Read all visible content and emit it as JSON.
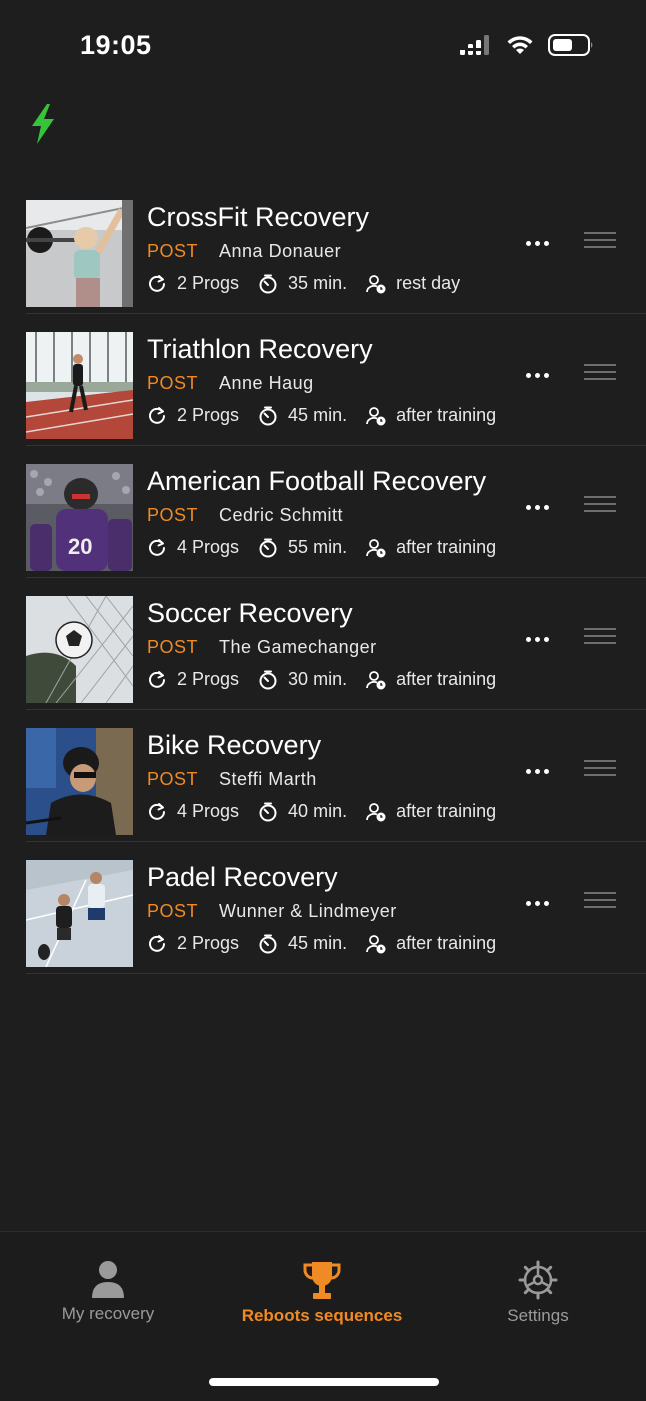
{
  "status": {
    "time": "19:05"
  },
  "colors": {
    "accent": "#f08a24",
    "bolt": "#35c43a",
    "background": "#1e1e1e"
  },
  "icons": {
    "header": "lightning-bolt-icon",
    "progs": "refresh-icon",
    "duration": "timer-icon",
    "timing": "user-clock-icon",
    "more": "more-dots-icon",
    "reorder": "drag-handle-icon"
  },
  "items": [
    {
      "title": "CrossFit Recovery",
      "tag": "POST",
      "author": "Anna Donauer",
      "progs": "2 Progs",
      "duration": "35 min.",
      "timing": "rest day"
    },
    {
      "title": "Triathlon Recovery",
      "tag": "POST",
      "author": "Anne Haug",
      "progs": "2 Progs",
      "duration": "45 min.",
      "timing": "after training"
    },
    {
      "title": "American Football Recovery",
      "tag": "POST",
      "author": "Cedric Schmitt",
      "progs": "4 Progs",
      "duration": "55 min.",
      "timing": "after training"
    },
    {
      "title": "Soccer Recovery",
      "tag": "POST",
      "author": "The Gamechanger",
      "progs": "2 Progs",
      "duration": "30 min.",
      "timing": "after training"
    },
    {
      "title": "Bike Recovery",
      "tag": "POST",
      "author": "Steffi Marth",
      "progs": "4 Progs",
      "duration": "40 min.",
      "timing": "after training"
    },
    {
      "title": "Padel Recovery",
      "tag": "POST",
      "author": "Wunner & Lindmeyer",
      "progs": "2 Progs",
      "duration": "45 min.",
      "timing": "after training"
    }
  ],
  "tabs": [
    {
      "label": "My recovery",
      "icon": "person-icon",
      "active": false
    },
    {
      "label": "Reboots sequences",
      "icon": "trophy-icon",
      "active": true
    },
    {
      "label": "Settings",
      "icon": "gear-icon",
      "active": false
    }
  ]
}
